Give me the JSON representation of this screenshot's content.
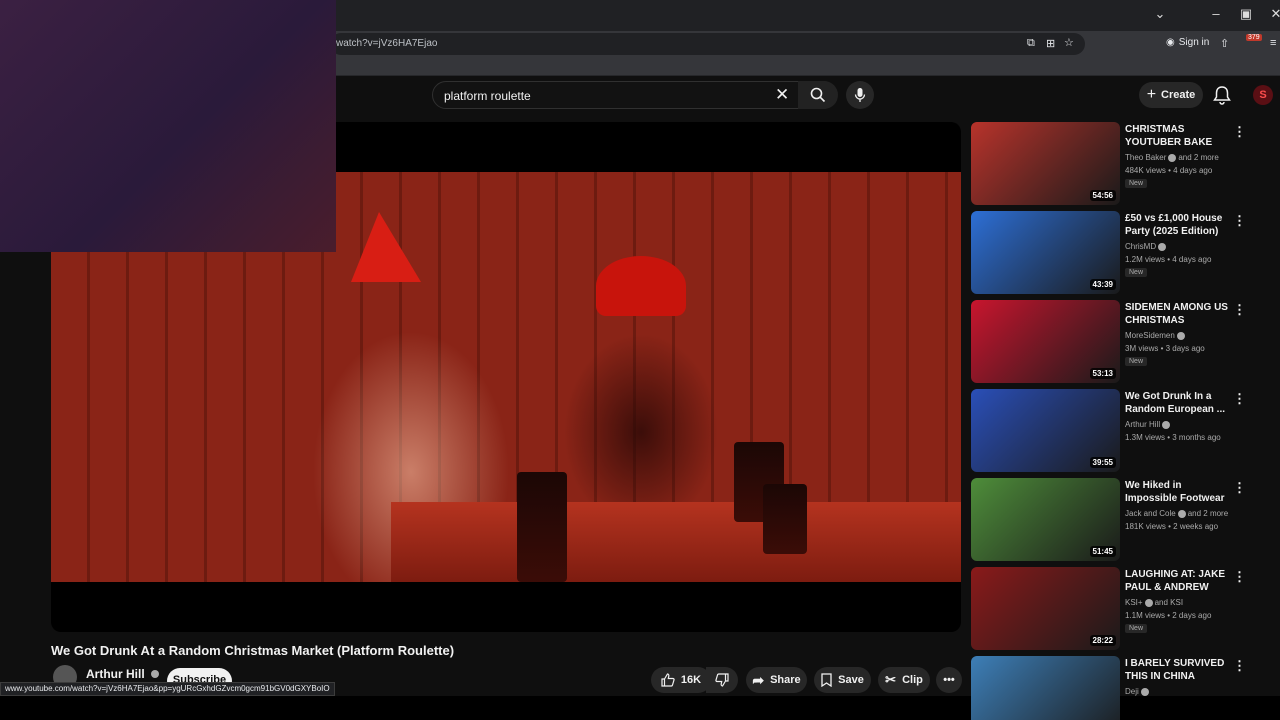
{
  "browser": {
    "url": "watch?v=jVz6HA7Ejao",
    "sign_in": "Sign in",
    "ext_badge": "379",
    "status_url": "www.youtube.com/watch?v=jVz6HA7Ejao&pp=ygURcGxhdGZvcm0gcm91bGV0dGXYBoIO"
  },
  "masthead": {
    "search_value": "platform roulette",
    "create_label": "Create"
  },
  "video": {
    "title": "We Got Drunk At a Random Christmas Market (Platform Roulette)",
    "channel": "Arthur Hill",
    "subscribe_label": "Subscribe",
    "likes": "16K",
    "share_label": "Share",
    "save_label": "Save",
    "clip_label": "Clip"
  },
  "recommendations": [
    {
      "title": "CHRISTMAS YOUTUBER BAKE OFF!",
      "channel": "Theo Baker",
      "channel_extra": "and 2 more",
      "stats": "484K views • 4 days ago",
      "badge": "New",
      "duration": "54:56",
      "color": "#b8332b"
    },
    {
      "title": "£50 vs £1,000 House Party (2025 Edition)",
      "channel": "ChrisMD",
      "channel_extra": "",
      "stats": "1.2M views • 4 days ago",
      "badge": "New",
      "duration": "43:39",
      "color": "#2d6fd6"
    },
    {
      "title": "SIDEMEN AMONG US CHRISTMAS SPECIAL...",
      "channel": "MoreSidemen",
      "channel_extra": "",
      "stats": "3M views • 3 days ago",
      "badge": "New",
      "duration": "53:13",
      "color": "#c8152e"
    },
    {
      "title": "We Got Drunk In a Random European ...",
      "channel": "Arthur Hill",
      "channel_extra": "",
      "stats": "1.3M views • 3 months ago",
      "badge": "",
      "duration": "39:55",
      "color": "#2a4fb8"
    },
    {
      "title": "We Hiked in Impossible Footwear",
      "channel": "Jack and Cole",
      "channel_extra": "and 2 more",
      "stats": "181K views • 2 weeks ago",
      "badge": "",
      "duration": "51:45",
      "color": "#4e8d3a"
    },
    {
      "title": "LAUGHING AT: JAKE PAUL & ANDREW TATE",
      "channel": "KSI+",
      "channel_extra": "and KSI",
      "stats": "1.1M views • 2 days ago",
      "badge": "New",
      "duration": "28:22",
      "color": "#8a1a1a"
    },
    {
      "title": "I BARELY SURVIVED THIS IN CHINA",
      "channel": "Deji",
      "channel_extra": "",
      "stats": "",
      "badge": "",
      "duration": "",
      "color": "#3d7fb8"
    }
  ]
}
